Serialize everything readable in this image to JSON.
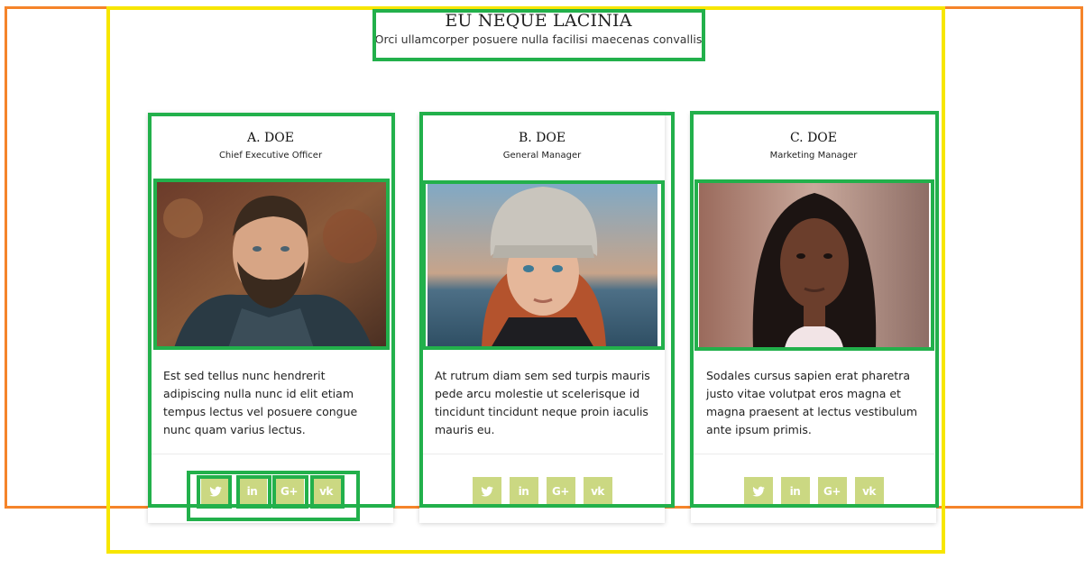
{
  "section": {
    "title": "EU NEQUE LACINIA",
    "subtitle": "Orci ullamcorper posuere nulla facilisi maecenas convallis"
  },
  "team": [
    {
      "name": "A. DOE",
      "role": "Chief Executive Officer",
      "description": "Est sed tellus nunc hendrerit adipiscing nulla nunc id elit etiam tempus lectus vel posuere congue nunc quam varius lectus.",
      "social": [
        "twitter-icon",
        "linkedin-icon",
        "google-plus-icon",
        "vk-icon"
      ]
    },
    {
      "name": "B. DOE",
      "role": "General Manager",
      "description": "At rutrum diam sem sed turpis mauris pede arcu molestie ut scelerisque id tincidunt tincidunt neque proin iaculis mauris eu.",
      "social": [
        "twitter-icon",
        "linkedin-icon",
        "google-plus-icon",
        "vk-icon"
      ]
    },
    {
      "name": "C. DOE",
      "role": "Marketing Manager",
      "description": "Sodales cursus sapien erat pharetra justo vitae volutpat eros magna et magna praesent at lectus vestibulum ante ipsum primis.",
      "social": [
        "twitter-icon",
        "linkedin-icon",
        "google-plus-icon",
        "vk-icon"
      ]
    }
  ],
  "colors": {
    "social_bg": "#cbd882",
    "box_green": "#22b04b",
    "box_orange": "#f5842a",
    "box_yellow": "#f7e600"
  }
}
